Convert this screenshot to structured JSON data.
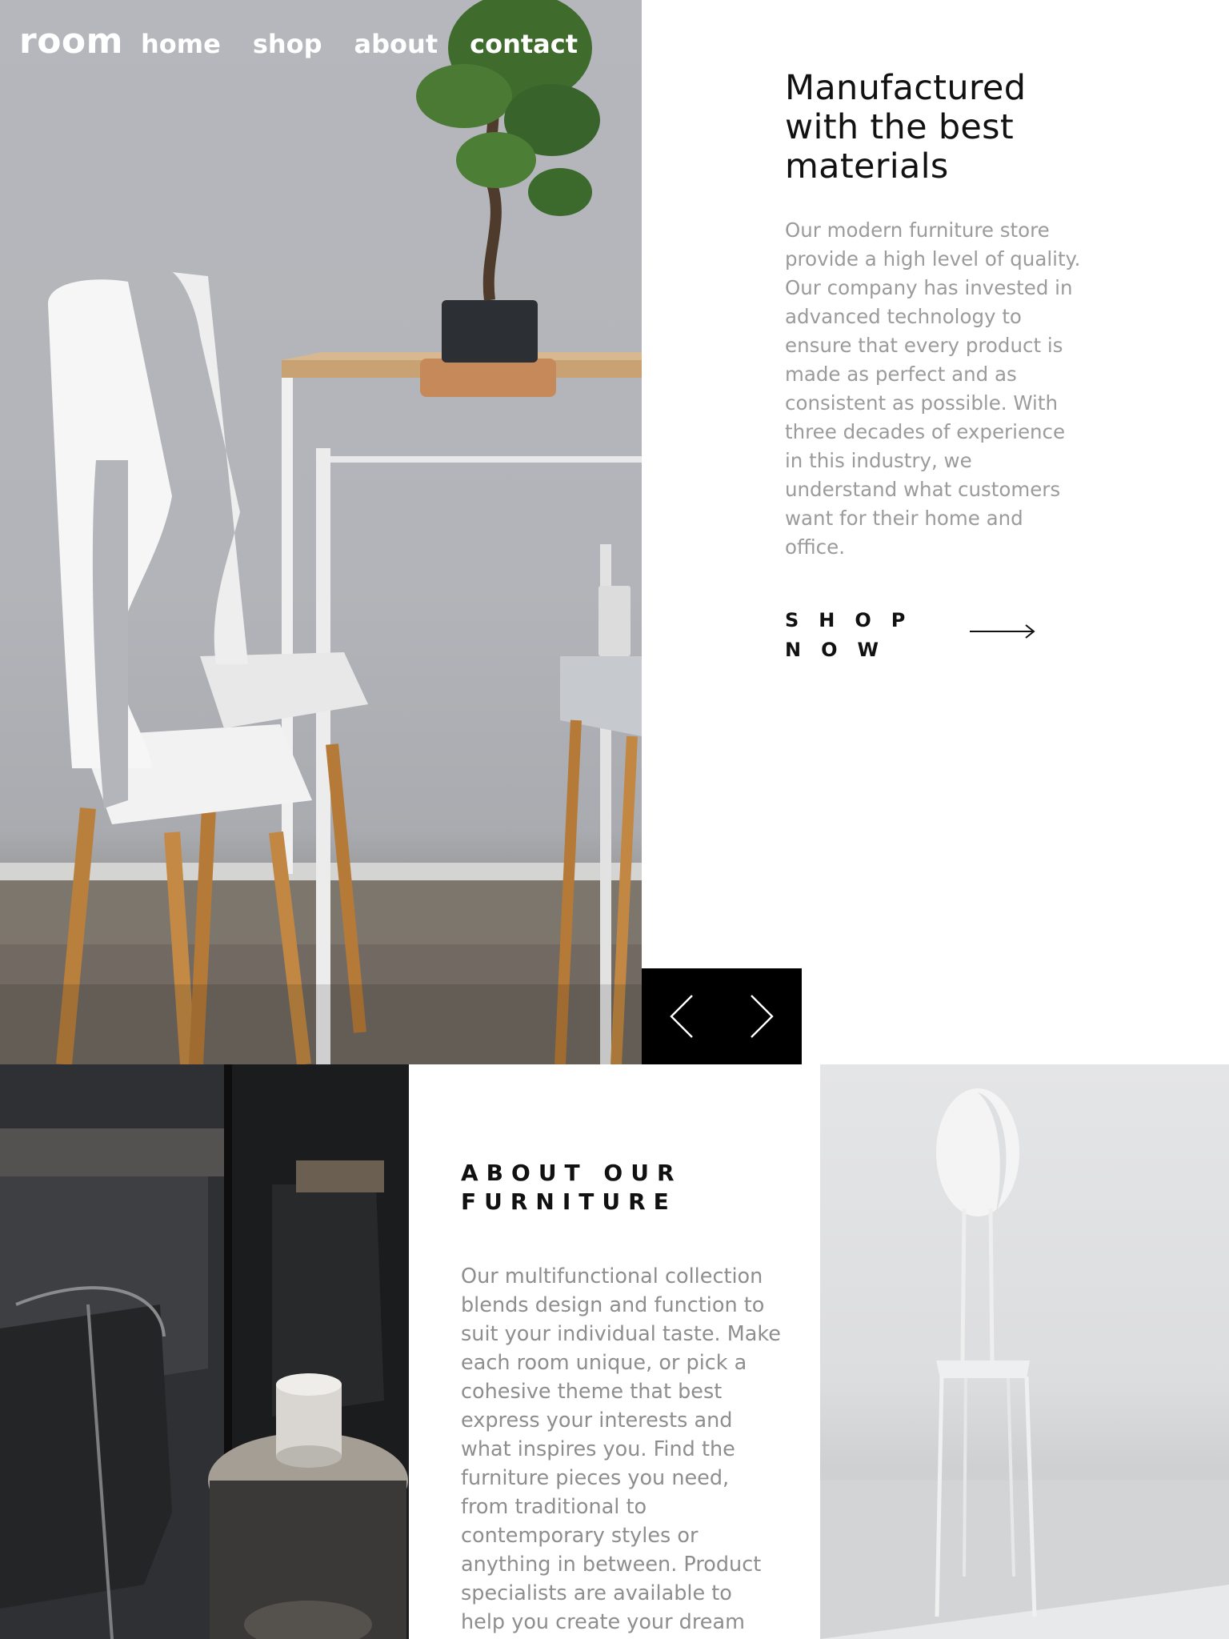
{
  "nav": {
    "logo": "room",
    "links": [
      "home",
      "shop",
      "about",
      "contact"
    ]
  },
  "hero": {
    "title_lines": [
      "Manufactured",
      "with the best",
      "materials"
    ],
    "description": "Our modern furniture store provide a high level of quality. Our company has invested in advanced technology to ensure that every product is made as perfect and as consistent as possible. With three decades of experience in this industry, we understand what customers want for their home and office.",
    "cta_label": "SHOP NOW",
    "cta_icon": "arrow-right-icon"
  },
  "slider": {
    "prev_icon": "chevron-left-icon",
    "next_icon": "chevron-right-icon"
  },
  "about": {
    "title": "ABOUT OUR FURNITURE",
    "description": "Our multifunctional collection blends design and function to suit your individual taste. Make each room unique, or pick a cohesive theme that best express your interests and what inspires you. Find the furniture pieces you need, from traditional to contemporary styles or anything in between. Product specialists are available to help you create your dream"
  },
  "colors": {
    "text_primary": "#111111",
    "text_muted": "#9b9b9b",
    "nav_text": "#ffffff",
    "slider_bg": "#000000"
  }
}
